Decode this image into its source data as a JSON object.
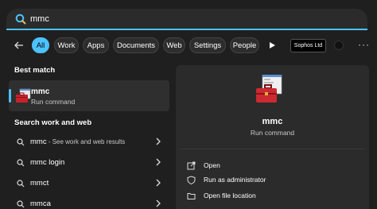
{
  "search": {
    "query": "mmc"
  },
  "filters": {
    "chips": [
      "All",
      "Work",
      "Apps",
      "Documents",
      "Web",
      "Settings",
      "People"
    ],
    "active": "All",
    "org": "Sophos Ltd"
  },
  "results": {
    "best_match_header": "Best match",
    "best_match": {
      "title": "mmc",
      "subtitle": "Run command"
    },
    "web_header": "Search work and web",
    "web_items": [
      {
        "bold": "mmc",
        "muted": " - See work and web results"
      },
      {
        "bold": "mmc login",
        "muted": ""
      },
      {
        "bold": "mmct",
        "muted": ""
      },
      {
        "bold": "mmca",
        "muted": ""
      }
    ]
  },
  "preview": {
    "title": "mmc",
    "subtitle": "Run command",
    "actions": [
      {
        "label": "Open",
        "icon": "open-external-icon"
      },
      {
        "label": "Run as administrator",
        "icon": "shield-icon"
      },
      {
        "label": "Open file location",
        "icon": "folder-icon"
      }
    ]
  },
  "colors": {
    "accent": "#4cc2ff",
    "background": "#1f1f1f",
    "panel": "#2b2b2b",
    "selected": "#2f2f2f"
  }
}
